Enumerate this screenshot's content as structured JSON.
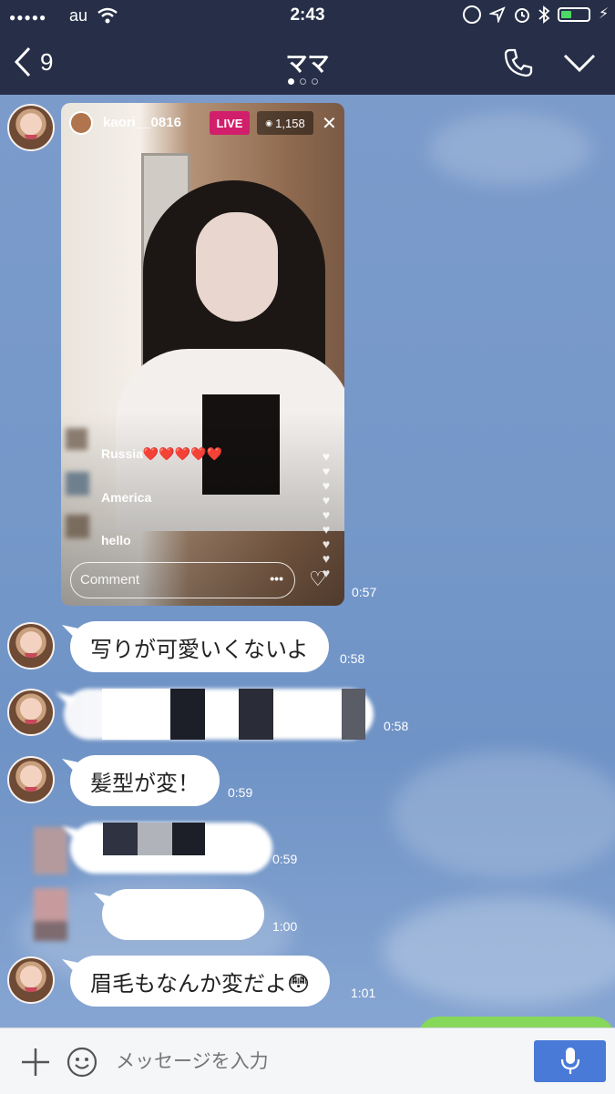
{
  "status_bar": {
    "carrier": "au",
    "time": "2:43"
  },
  "header": {
    "back_count": "9",
    "title": "ママ",
    "page_dots": 3,
    "active_dot": 0
  },
  "live": {
    "username": "kaori__0816",
    "live_badge": "LIVE",
    "viewers": "1,158",
    "comments": [
      {
        "label": "Russia❤️❤️❤️❤️❤️"
      },
      {
        "label": "America"
      },
      {
        "label": "hello"
      }
    ],
    "comment_placeholder": "Comment",
    "time": "0:57"
  },
  "messages": [
    {
      "text": "写りが可愛いくないよ",
      "time": "0:58"
    },
    {
      "text": "",
      "time": "0:58"
    },
    {
      "text": "髪型が変！",
      "time": "0:59"
    },
    {
      "text": "",
      "time": "0:59"
    },
    {
      "text": "",
      "time": "1:00"
    },
    {
      "text": "眉毛もなんか変だよ😳",
      "time": "1:01"
    }
  ],
  "input": {
    "placeholder": "メッセージを入力"
  },
  "colors": {
    "header_bg": "#262f47",
    "chat_bg": "#7598c9",
    "send_button": "#4a7ad8",
    "live_badge": "#d21f6b"
  }
}
